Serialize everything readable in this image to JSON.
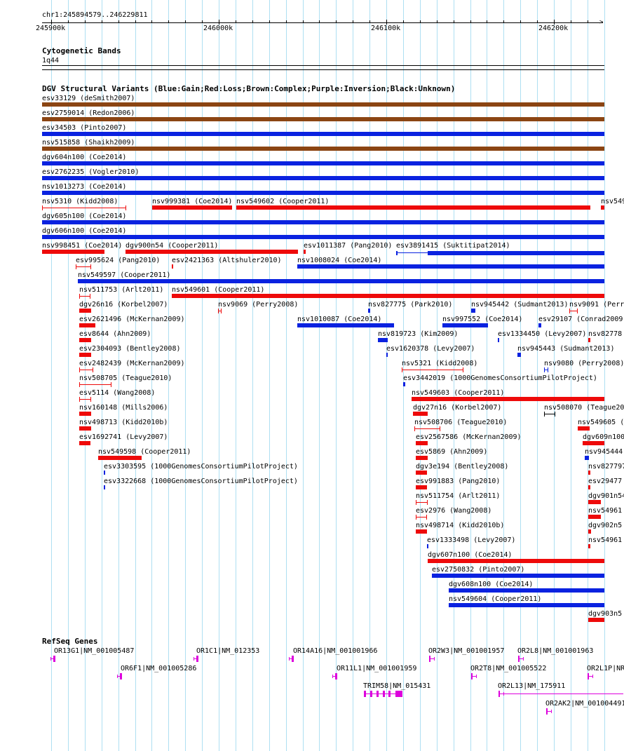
{
  "colors": {
    "gain": "#0a22e0",
    "loss": "#ee0a0a",
    "complex": "#8b4513",
    "inversion": "#800080",
    "unknown": "#000000",
    "gene": "#dd00dd",
    "grid": "#aedff2"
  },
  "ruler": {
    "coordinates": "chr1:245894579..246229811",
    "ticks": [
      "245900k",
      "246000k",
      "246100k",
      "246200k"
    ]
  },
  "cytoband": {
    "title": "Cytogenetic Bands",
    "band": "1q44"
  },
  "dgv": {
    "title": "DGV Structural Variants (Blue:Gain;Red:Loss;Brown:Complex;Purple:Inversion;Black:Unknown)",
    "features": [
      {
        "label": "esv33129 (deSmith2007)",
        "type": "complex"
      },
      {
        "label": "esv2759014 (Redon2006)",
        "type": "complex"
      },
      {
        "label": "esv34503 (Pinto2007)",
        "type": "gain"
      },
      {
        "label": "nsv515858 (Shaikh2009)",
        "type": "complex"
      },
      {
        "label": "dgv604n100 (Coe2014)",
        "type": "gain"
      },
      {
        "label": "esv2762235 (Vogler2010)",
        "type": "gain"
      },
      {
        "label": "nsv1013273 (Coe2014)",
        "type": "gain"
      },
      {
        "label": "nsv5310 (Kidd2008)",
        "type": "loss"
      },
      {
        "label": "nsv999381 (Coe2014)",
        "type": "loss"
      },
      {
        "label": "nsv549602 (Cooper2011)",
        "type": "loss"
      },
      {
        "label": "nsv549",
        "type": "loss"
      },
      {
        "label": "dgv605n100 (Coe2014)",
        "type": "gain"
      },
      {
        "label": "dgv606n100 (Coe2014)",
        "type": "gain"
      },
      {
        "label": "nsv998451 (Coe2014)",
        "type": "loss"
      },
      {
        "label": "dgv900n54 (Cooper2011)",
        "type": "loss"
      },
      {
        "label": "esv1011387 (Pang2010)",
        "type": "loss"
      },
      {
        "label": "esv3891415 (Suktitipat2014)",
        "type": "gain"
      },
      {
        "label": "esv995624 (Pang2010)",
        "type": "loss"
      },
      {
        "label": "esv2421363 (Altshuler2010)",
        "type": "loss"
      },
      {
        "label": "nsv1008024 (Coe2014)",
        "type": "gain"
      },
      {
        "label": "nsv549597 (Cooper2011)",
        "type": "gain"
      },
      {
        "label": "nsv511753 (Arlt2011)",
        "type": "loss"
      },
      {
        "label": "nsv549601 (Cooper2011)",
        "type": "loss"
      },
      {
        "label": "dgv26n16 (Korbel2007)",
        "type": "loss"
      },
      {
        "label": "nsv9069 (Perry2008)",
        "type": "loss"
      },
      {
        "label": "nsv827775 (Park2010)",
        "type": "gain"
      },
      {
        "label": "nsv945442 (Sudmant2013)",
        "type": "gain"
      },
      {
        "label": "nsv9091 (Perr",
        "type": "loss"
      },
      {
        "label": "esv2621496 (McKernan2009)",
        "type": "loss"
      },
      {
        "label": "nsv1010087 (Coe2014)",
        "type": "gain"
      },
      {
        "label": "nsv997552 (Coe2014)",
        "type": "gain"
      },
      {
        "label": "esv29107 (Conrad2009)",
        "type": "gain"
      },
      {
        "label": "esv8644 (Ahn2009)",
        "type": "loss"
      },
      {
        "label": "nsv819723 (Kim2009)",
        "type": "gain"
      },
      {
        "label": "esv1334450 (Levy2007)",
        "type": "gain"
      },
      {
        "label": "nsv82778",
        "type": "loss"
      },
      {
        "label": "esv2304093 (Bentley2008)",
        "type": "loss"
      },
      {
        "label": "esv1620378 (Levy2007)",
        "type": "gain"
      },
      {
        "label": "nsv945443 (Sudmant2013)",
        "type": "gain"
      },
      {
        "label": "esv2482439 (McKernan2009)",
        "type": "loss"
      },
      {
        "label": "nsv5321 (Kidd2008)",
        "type": "loss"
      },
      {
        "label": "nsv9080 (Perry2008)",
        "type": "gain"
      },
      {
        "label": "nsv508705 (Teague2010)",
        "type": "loss"
      },
      {
        "label": "esv3442019 (1000GenomesConsortiumPilotProject)",
        "type": "gain"
      },
      {
        "label": "esv5114 (Wang2008)",
        "type": "loss"
      },
      {
        "label": "nsv549603 (Cooper2011)",
        "type": "loss"
      },
      {
        "label": "nsv160148 (Mills2006)",
        "type": "loss"
      },
      {
        "label": "dgv27n16 (Korbel2007)",
        "type": "loss"
      },
      {
        "label": "nsv508070 (Teague20",
        "type": "unknown"
      },
      {
        "label": "nsv498713 (Kidd2010b)",
        "type": "loss"
      },
      {
        "label": "nsv508706 (Teague2010)",
        "type": "loss"
      },
      {
        "label": "nsv549605 (",
        "type": "loss"
      },
      {
        "label": "esv1692741 (Levy2007)",
        "type": "loss"
      },
      {
        "label": "esv2567586 (McKernan2009)",
        "type": "loss"
      },
      {
        "label": "dgv609n100",
        "type": "loss"
      },
      {
        "label": "nsv549598 (Cooper2011)",
        "type": "loss"
      },
      {
        "label": "esv5869 (Ahn2009)",
        "type": "loss"
      },
      {
        "label": "nsv945444",
        "type": "gain"
      },
      {
        "label": "esv3303595 (1000GenomesConsortiumPilotProject)",
        "type": "gain"
      },
      {
        "label": "dgv3e194 (Bentley2008)",
        "type": "loss"
      },
      {
        "label": "nsv827797",
        "type": "loss"
      },
      {
        "label": "esv3322668 (1000GenomesConsortiumPilotProject)",
        "type": "gain"
      },
      {
        "label": "esv991883 (Pang2010)",
        "type": "loss"
      },
      {
        "label": "esv29477",
        "type": "loss"
      },
      {
        "label": "nsv511754 (Arlt2011)",
        "type": "loss"
      },
      {
        "label": "dgv901n54",
        "type": "loss"
      },
      {
        "label": "esv2976 (Wang2008)",
        "type": "loss"
      },
      {
        "label": "nsv54961",
        "type": "loss"
      },
      {
        "label": "nsv498714 (Kidd2010b)",
        "type": "loss"
      },
      {
        "label": "dgv902n5",
        "type": "loss"
      },
      {
        "label": "esv1333498 (Levy2007)",
        "type": "gain"
      },
      {
        "label": "nsv54961",
        "type": "loss"
      },
      {
        "label": "dgv607n100 (Coe2014)",
        "type": "loss"
      },
      {
        "label": "esv2750832 (Pinto2007)",
        "type": "gain"
      },
      {
        "label": "dgv608n100 (Coe2014)",
        "type": "gain"
      },
      {
        "label": "nsv549604 (Cooper2011)",
        "type": "gain"
      },
      {
        "label": "dgv903n5",
        "type": "loss"
      }
    ]
  },
  "refseq": {
    "title": "RefSeq Genes",
    "genes": [
      {
        "label": "OR13G1|NM_001005487"
      },
      {
        "label": "OR1C1|NM_012353"
      },
      {
        "label": "OR14A16|NM_001001966"
      },
      {
        "label": "OR2W3|NM_001001957"
      },
      {
        "label": "OR2L8|NM_001001963"
      },
      {
        "label": "OR6F1|NM_001005286"
      },
      {
        "label": "OR11L1|NM_001001959"
      },
      {
        "label": "OR2T8|NM_001005522"
      },
      {
        "label": "OR2L1P|NR"
      },
      {
        "label": "TRIM58|NM_015431"
      },
      {
        "label": "OR2L13|NM_175911"
      },
      {
        "label": "OR2AK2|NM_001004491"
      }
    ]
  }
}
